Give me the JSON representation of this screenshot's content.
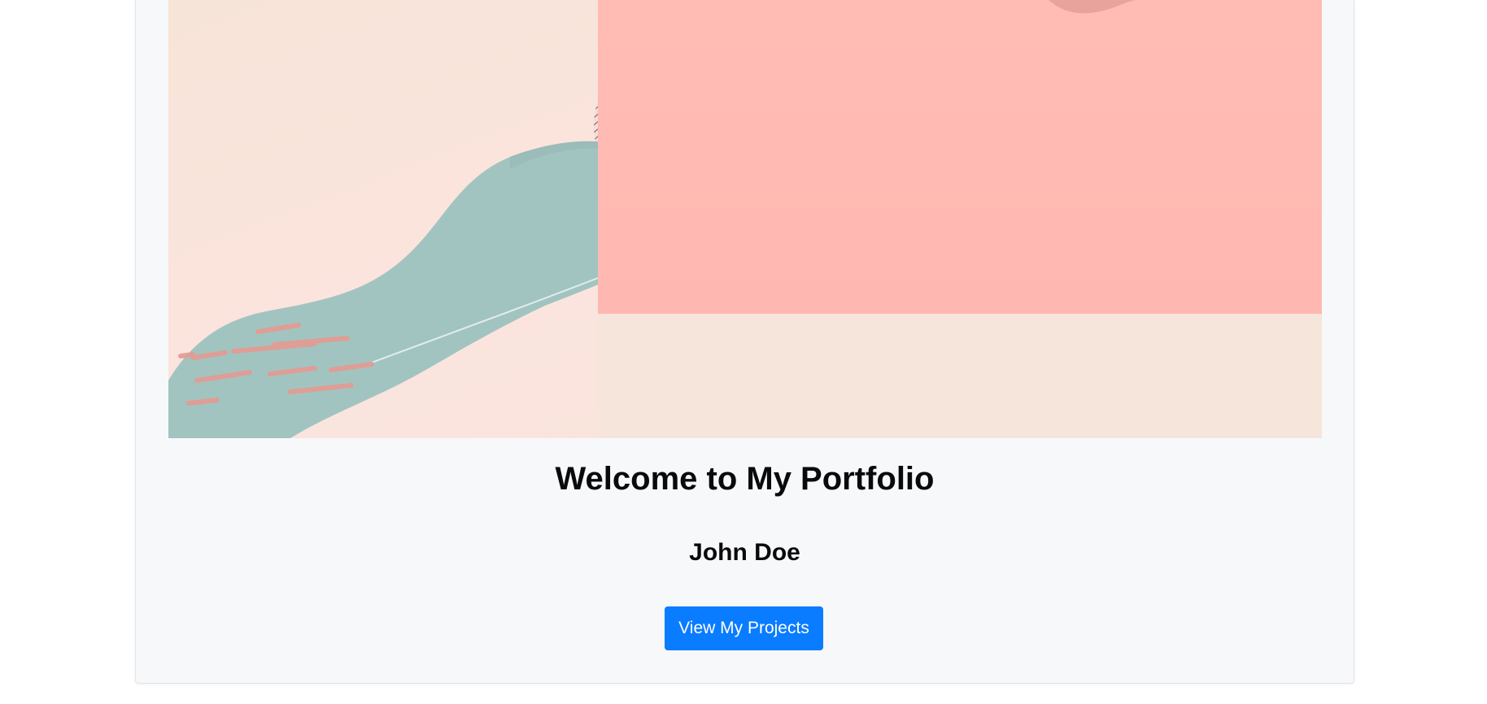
{
  "hero": {
    "title": "Welcome to My Portfolio",
    "name": "John Doe",
    "cta_label": "View My Projects",
    "artwork": "abstract-pastel-shapes"
  },
  "colors": {
    "page_bg": "#ffffff",
    "card_bg": "#f7f8fa",
    "button_bg": "#0a7cff",
    "button_text": "#ffffff",
    "art_cream": "#f6e5d9",
    "art_pink": "#ffbab3",
    "art_teal": "#a2c4c0",
    "art_stroke": "#e59a92",
    "art_hatch": "#6b4a56"
  }
}
